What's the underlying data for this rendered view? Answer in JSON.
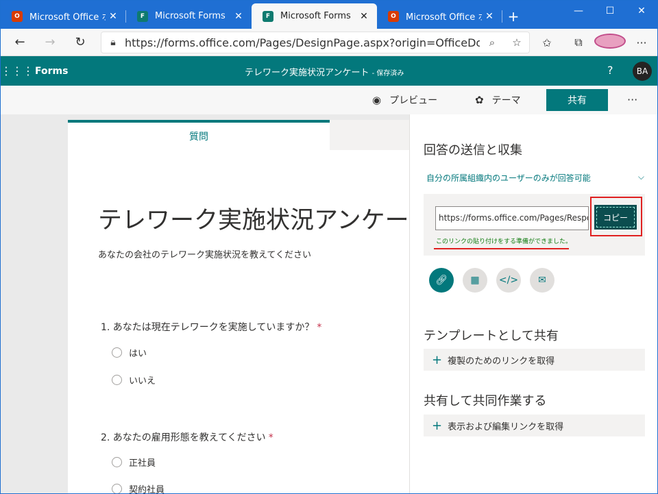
{
  "browser": {
    "tabs": [
      {
        "title": "Microsoft Office ホーム",
        "favicon": "office-icon",
        "active": false
      },
      {
        "title": "Microsoft Forms",
        "favicon": "forms-icon",
        "active": false
      },
      {
        "title": "Microsoft Forms",
        "favicon": "forms-icon",
        "active": true
      },
      {
        "title": "Microsoft Office ホーム",
        "favicon": "office-icon",
        "active": false
      }
    ],
    "url": "https://forms.office.com/Pages/DesignPage.aspx?origin=OfficeDotC...",
    "accent_color": "#1f6fd3"
  },
  "forms_header": {
    "app_name": "Forms",
    "doc_title": "テレワーク実施状況アンケート",
    "doc_status": "保存済み",
    "help": "?",
    "user_initials": "BA",
    "brand_color": "#03787c"
  },
  "command_bar": {
    "preview_label": "プレビュー",
    "theme_label": "テーマ",
    "share_label": "共有",
    "more_label": "···"
  },
  "form": {
    "tab_label": "質問",
    "title": "テレワーク実施状況アンケー",
    "description": "あなたの会社のテレワーク実施状況を教えてください",
    "questions": [
      {
        "text": "1. あなたは現在テレワークを実施していますか？",
        "required_mark": "*",
        "options": [
          "はい",
          "いいえ"
        ]
      },
      {
        "text": "2. あなたの雇用形態を教えてください",
        "required_mark": "*",
        "options": [
          "正社員",
          "契約社員"
        ]
      }
    ]
  },
  "share_panel": {
    "title": "回答の送信と収集",
    "permission": "自分の所属組織内のユーザーのみが回答可能",
    "link_value": "https://forms.office.com/Pages/Respon",
    "copy_label": "コピー",
    "copied_message": "このリンクの貼り付けをする準備ができました。",
    "template_title": "テンプレートとして共有",
    "template_button": "複製のためのリンクを取得",
    "collab_title": "共有して共同作業する",
    "collab_button": "表示および編集リンクを取得"
  }
}
